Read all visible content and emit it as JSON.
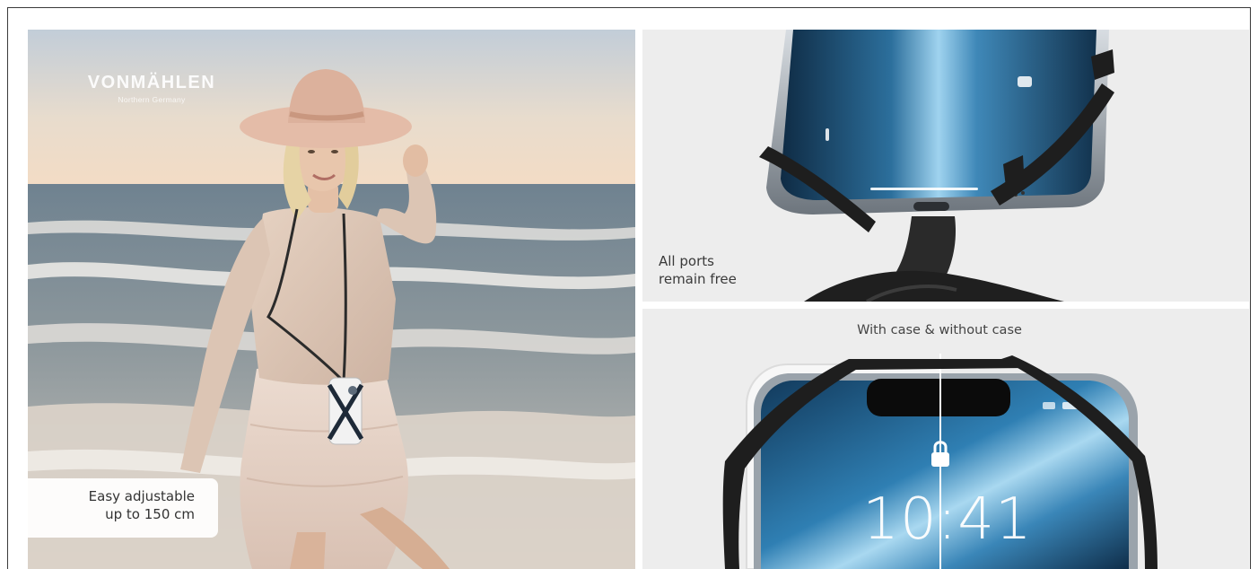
{
  "brand": {
    "name": "VONMÄHLEN",
    "tagline": "Northern Germany"
  },
  "panels": {
    "beach": {
      "caption_line1": "Easy adjustable",
      "caption_line2": "up to 150 cm"
    },
    "ports": {
      "caption_line1": "All ports",
      "caption_line2": "remain free"
    },
    "case": {
      "title": "With case & without case",
      "clock": "10:41"
    }
  },
  "colors": {
    "panel_background": "#ededed",
    "caption_background": "#ffffff",
    "caption_text": "#333333",
    "strap": "#1e1e1e"
  }
}
